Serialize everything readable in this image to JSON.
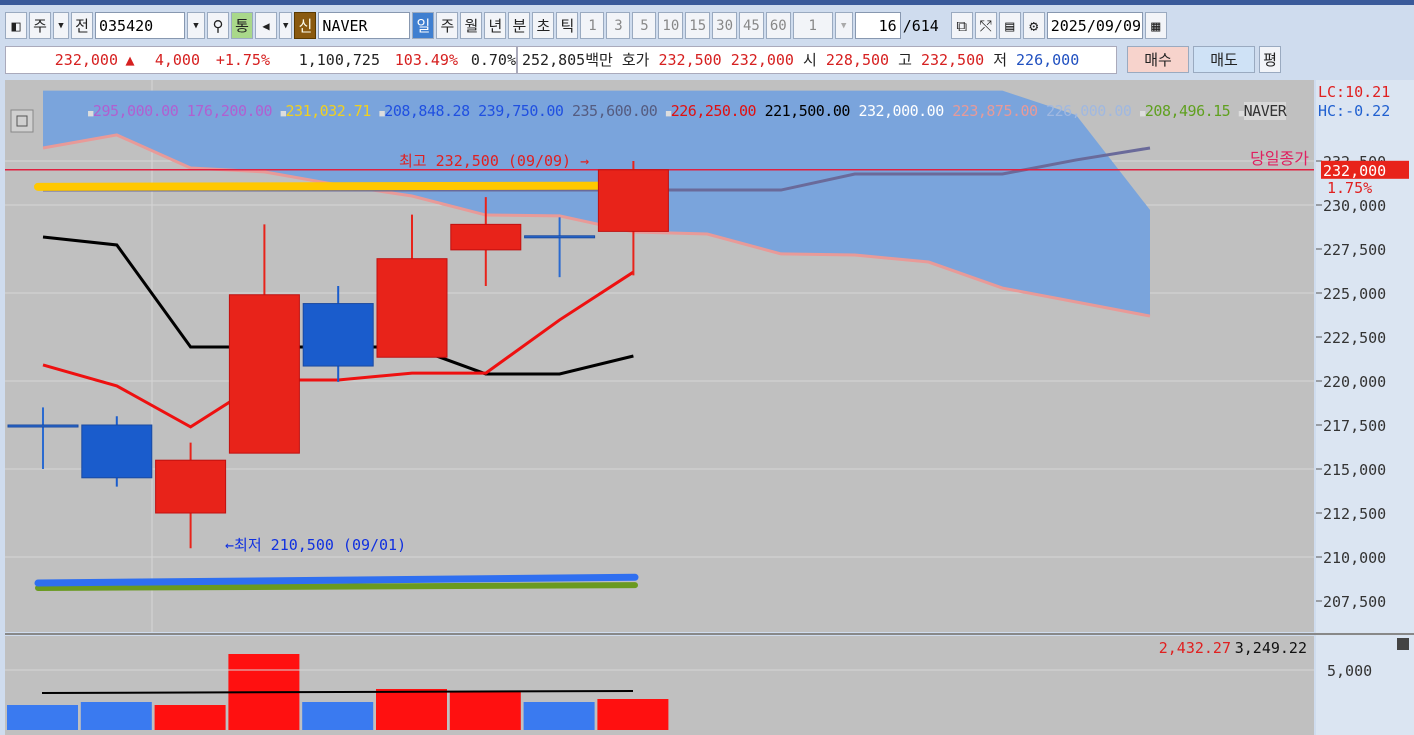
{
  "toolbar": {
    "market": "주",
    "all": "전",
    "code": "035420",
    "comm": "통",
    "credit": "신",
    "name": "NAVER",
    "periods": [
      "일",
      "주",
      "월",
      "년",
      "분",
      "초",
      "틱"
    ],
    "intervals": [
      "1",
      "3",
      "5",
      "10",
      "15",
      "30",
      "45",
      "60"
    ],
    "multiplier": "1",
    "count": "16",
    "total": "/614",
    "date": "2025/09/09"
  },
  "quote": {
    "price": "232,000",
    "arrow": "▲",
    "change": "4,000",
    "pct": "+1.75%",
    "volume": "1,100,725",
    "vol_ratio": "103.49%",
    "turnover": "0.70%",
    "amount": "252,805백만",
    "ask_label": "호가",
    "ask": "232,500",
    "bid": "232,000",
    "open_label": "시",
    "open": "228,500",
    "high_label": "고",
    "high": "232,500",
    "low_label": "저",
    "low": "226,000",
    "buy": "매수",
    "sell": "매도",
    "eval": "평"
  },
  "legend": {
    "v1": "295,000.00",
    "v2": "176,200.00",
    "v3": "231,032.71",
    "v4": "208,848.28",
    "v5": "239,750.00",
    "v6": "235,600.00",
    "v7": "226,250.00",
    "v8": "221,500.00",
    "v9": "232,000.00",
    "v10": "223,875.00",
    "v11": "226,000.00",
    "v12": "208,496.15",
    "stock": "NAVER"
  },
  "axis": {
    "lc": "LC:10.21",
    "hc": "HC:-0.22",
    "labels": [
      "232,500",
      "230,000",
      "227,500",
      "225,000",
      "222,500",
      "220,000",
      "217,500",
      "215,000",
      "212,500",
      "210,000",
      "207,500"
    ],
    "current": "232,000",
    "current_pct": "1.75%",
    "close_label": "당일종가"
  },
  "annotations": {
    "high": "최고 232,500 (09/09) →",
    "low": "←최저 210,500 (09/01)"
  },
  "volume": {
    "legend1": "2,432.27",
    "legend2": "3,249.22",
    "axis": "5,000"
  },
  "chart_data": {
    "type": "candlestick",
    "candles": [
      {
        "o": 217500,
        "h": 218500,
        "l": 215000,
        "c": 217500
      },
      {
        "o": 217500,
        "h": 218000,
        "l": 214000,
        "c": 214500
      },
      {
        "o": 212500,
        "h": 216500,
        "l": 210500,
        "c": 215500
      },
      {
        "o": 215900,
        "h": 228900,
        "l": 215900,
        "c": 224900
      },
      {
        "o": 224400,
        "h": 225400,
        "l": 219950,
        "c": 220850
      },
      {
        "o": 221350,
        "h": 229450,
        "l": 221350,
        "c": 226950
      },
      {
        "o": 227450,
        "h": 230450,
        "l": 225400,
        "c": 228900
      },
      {
        "o": 228250,
        "h": 229300,
        "l": 225900,
        "c": 228250
      },
      {
        "o": 228500,
        "h": 232500,
        "l": 226000,
        "c": 232000
      }
    ],
    "volumes": [
      2083,
      2333,
      2083,
      6333,
      2333,
      3417,
      3250,
      2333,
      2583
    ],
    "ma_black": [
      228180,
      227730,
      221930,
      221930,
      221930,
      221930,
      220400,
      220400,
      221420
    ],
    "ma_red": [
      220910,
      219720,
      217390,
      220060,
      220060,
      220450,
      220450,
      223470,
      226190
    ],
    "span_pink": [
      233240,
      233980,
      232100,
      231880,
      231140,
      230510,
      229430,
      229380,
      228470,
      228350,
      227220,
      227160,
      226760,
      225280,
      224490,
      223690
    ],
    "span_purple": [
      230850,
      230850,
      230850,
      230850,
      230850,
      230850,
      230850,
      230850,
      230850,
      230850,
      230850,
      231760,
      231760,
      231760,
      232560,
      233240
    ],
    "cloud_top": [
      236500,
      236500,
      236500,
      236500,
      236500,
      236500,
      236500,
      236500,
      236500,
      236500,
      236500,
      236500,
      236500,
      236500,
      235110,
      229720
    ],
    "vol_ma": 3249,
    "yrange": [
      206000,
      237000
    ]
  }
}
